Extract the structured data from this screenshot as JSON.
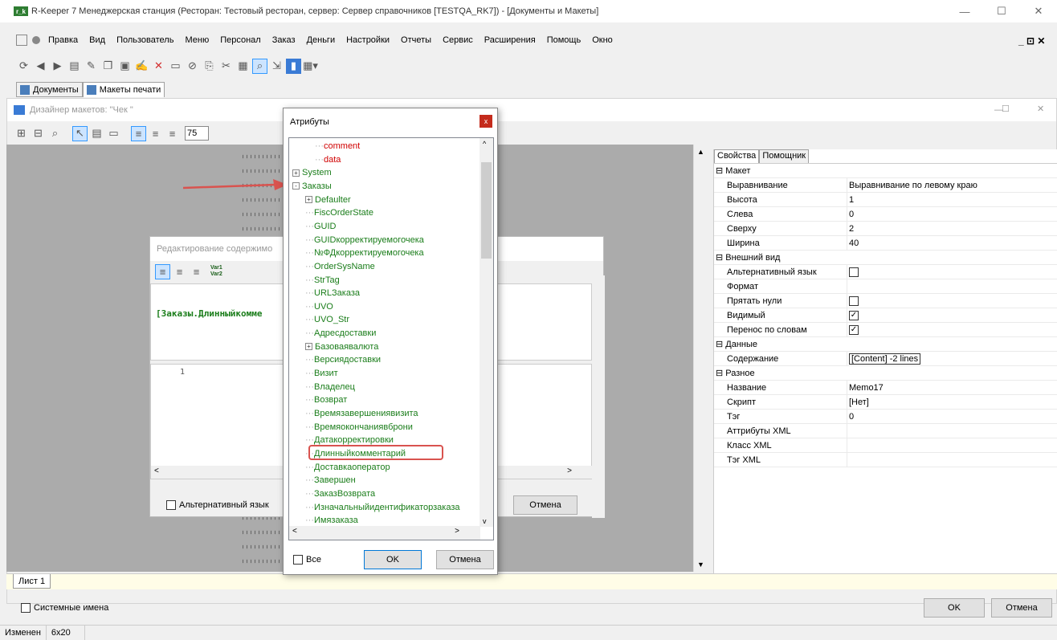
{
  "window": {
    "title": "R-Keeper 7 Менеджерская станция (Ресторан: Тестовый ресторан, сервер: Сервер справочников [TESTQA_RK7]) - [Документы и Макеты]",
    "logo": "r_k"
  },
  "menu": [
    "Правка",
    "Вид",
    "Пользователь",
    "Меню",
    "Персонал",
    "Заказ",
    "Деньги",
    "Настройки",
    "Отчеты",
    "Сервис",
    "Расширения",
    "Помощь",
    "Окно"
  ],
  "tabs": [
    {
      "label": "Документы"
    },
    {
      "label": "Макеты печати"
    }
  ],
  "designer": {
    "title": "Дизайнер макетов: \"Чек              \"",
    "zoom": "75"
  },
  "edit_dialog": {
    "title": "Редактирование содержимо",
    "var_btn": "Var1 Var2",
    "preview_text": "[Заказы.Длинныйкомме",
    "line_number": "1",
    "alt_lang": "Альтернативный язык",
    "cancel": "Отмена"
  },
  "attributes_dialog": {
    "title": "Атрибуты",
    "close": "x",
    "items": [
      {
        "label": "comment",
        "color": "red",
        "level": 2
      },
      {
        "label": "data",
        "color": "red",
        "level": 2
      },
      {
        "label": "System",
        "color": "green",
        "level": 0,
        "exp": "+"
      },
      {
        "label": "Заказы",
        "color": "green",
        "level": 0,
        "exp": "-"
      },
      {
        "label": "Defaulter",
        "color": "green",
        "level": 1,
        "exp": "+"
      },
      {
        "label": "FiscOrderState",
        "color": "green",
        "level": 1
      },
      {
        "label": "GUID",
        "color": "green",
        "level": 1
      },
      {
        "label": "GUIDкорректируемогочека",
        "color": "green",
        "level": 1
      },
      {
        "label": "№ФДкорректируемогочека",
        "color": "green",
        "level": 1
      },
      {
        "label": "OrderSysName",
        "color": "green",
        "level": 1
      },
      {
        "label": "StrTag",
        "color": "green",
        "level": 1
      },
      {
        "label": "URLЗаказа",
        "color": "green",
        "level": 1
      },
      {
        "label": "UVO",
        "color": "green",
        "level": 1
      },
      {
        "label": "UVO_Str",
        "color": "green",
        "level": 1
      },
      {
        "label": "Адресдоставки",
        "color": "green",
        "level": 1
      },
      {
        "label": "Базоваявалюта",
        "color": "green",
        "level": 1,
        "exp": "+"
      },
      {
        "label": "Версиядоставки",
        "color": "green",
        "level": 1
      },
      {
        "label": "Визит",
        "color": "green",
        "level": 1
      },
      {
        "label": "Владелец",
        "color": "green",
        "level": 1
      },
      {
        "label": "Возврат",
        "color": "green",
        "level": 1
      },
      {
        "label": "Времязавершениявизита",
        "color": "green",
        "level": 1
      },
      {
        "label": "Времяокончаниявброни",
        "color": "green",
        "level": 1
      },
      {
        "label": "Датакорректировки",
        "color": "green",
        "level": 1
      },
      {
        "label": "Длинныйкомментарий",
        "color": "green",
        "level": 1
      },
      {
        "label": "Доставкаоператор",
        "color": "green",
        "level": 1
      },
      {
        "label": "Завершен",
        "color": "green",
        "level": 1
      },
      {
        "label": "ЗаказВозврата",
        "color": "green",
        "level": 1
      },
      {
        "label": "Изначальныйидентификаторзаказа",
        "color": "green",
        "level": 1
      },
      {
        "label": "Имязаказа",
        "color": "green",
        "level": 1
      }
    ],
    "all_label": "Все",
    "ok": "OK",
    "cancel": "Отмена"
  },
  "properties": {
    "tabs": [
      "Свойства",
      "Помощник"
    ],
    "rows": [
      {
        "k": "Макет",
        "group": true
      },
      {
        "k": "Выравнивание",
        "v": "Выравнивание по левому краю"
      },
      {
        "k": "Высота",
        "v": "1"
      },
      {
        "k": "Слева",
        "v": "0"
      },
      {
        "k": "Сверху",
        "v": "2"
      },
      {
        "k": "Ширина",
        "v": "40"
      },
      {
        "k": "Внешний вид",
        "group": true
      },
      {
        "k": "Альтернативный язык",
        "chk": false
      },
      {
        "k": "Формат",
        "v": ""
      },
      {
        "k": "Прятать нули",
        "chk": false
      },
      {
        "k": "Видимый",
        "chk": true
      },
      {
        "k": "Перенос по словам",
        "chk": true
      },
      {
        "k": "Данные",
        "group": true
      },
      {
        "k": "Содержание",
        "v": "[Content] -2 lines"
      },
      {
        "k": "Разное",
        "group": true
      },
      {
        "k": "Название",
        "v": "Memo17"
      },
      {
        "k": "Скрипт",
        "v": "[Нет]"
      },
      {
        "k": "Тэг",
        "v": "0"
      },
      {
        "k": "Аттрибуты XML",
        "v": ""
      },
      {
        "k": "Класс XML",
        "v": ""
      },
      {
        "k": "Тэг XML",
        "v": ""
      }
    ]
  },
  "sheet_tab": "Лист 1",
  "bottom": {
    "system_names": "Системные имена",
    "ok": "OK",
    "cancel": "Отмена"
  },
  "status": {
    "state": "Изменен",
    "size": "6x20"
  },
  "colors": {
    "highlight": "#d9534f",
    "tree_green": "#1a7d1a",
    "tree_red": "#d00000"
  }
}
